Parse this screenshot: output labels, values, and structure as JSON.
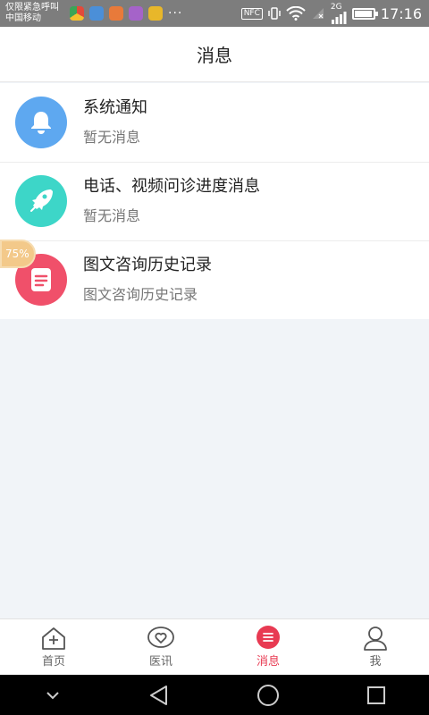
{
  "status_bar": {
    "line1": "仅限紧急呼叫",
    "line2": "中国移动",
    "dots": "···",
    "nfc": "NFC",
    "network": "2G",
    "time": "17:16",
    "battery_level": 0.85,
    "app_icons": [
      {
        "name": "chrome-icon",
        "color": "#e34a3a"
      },
      {
        "name": "browser-icon",
        "color": "#4b8fd8"
      },
      {
        "name": "app-icon",
        "color": "#e87a3a"
      },
      {
        "name": "gallery-icon",
        "color": "#a563c9"
      },
      {
        "name": "weibo-icon",
        "color": "#e8b72a"
      }
    ]
  },
  "header": {
    "title": "消息"
  },
  "messages": [
    {
      "title": "系统通知",
      "subtitle": "暂无消息",
      "icon": "bell-icon",
      "color": "#5ea8f0"
    },
    {
      "title": "电话、视频问诊进度消息",
      "subtitle": "暂无消息",
      "icon": "rocket-icon",
      "color": "#3dd6c8"
    },
    {
      "title": "图文咨询历史记录",
      "subtitle": "图文咨询历史记录",
      "icon": "document-icon",
      "color": "#f0506a"
    }
  ],
  "floating_badge": "75%",
  "tabs": [
    {
      "label": "首页",
      "icon": "home-icon",
      "active": false
    },
    {
      "label": "医讯",
      "icon": "heart-chat-icon",
      "active": false
    },
    {
      "label": "消息",
      "icon": "message-icon",
      "active": true
    },
    {
      "label": "我",
      "icon": "user-icon",
      "active": false
    }
  ],
  "colors": {
    "accent": "#e83a52",
    "background": "#f1f4f8"
  }
}
